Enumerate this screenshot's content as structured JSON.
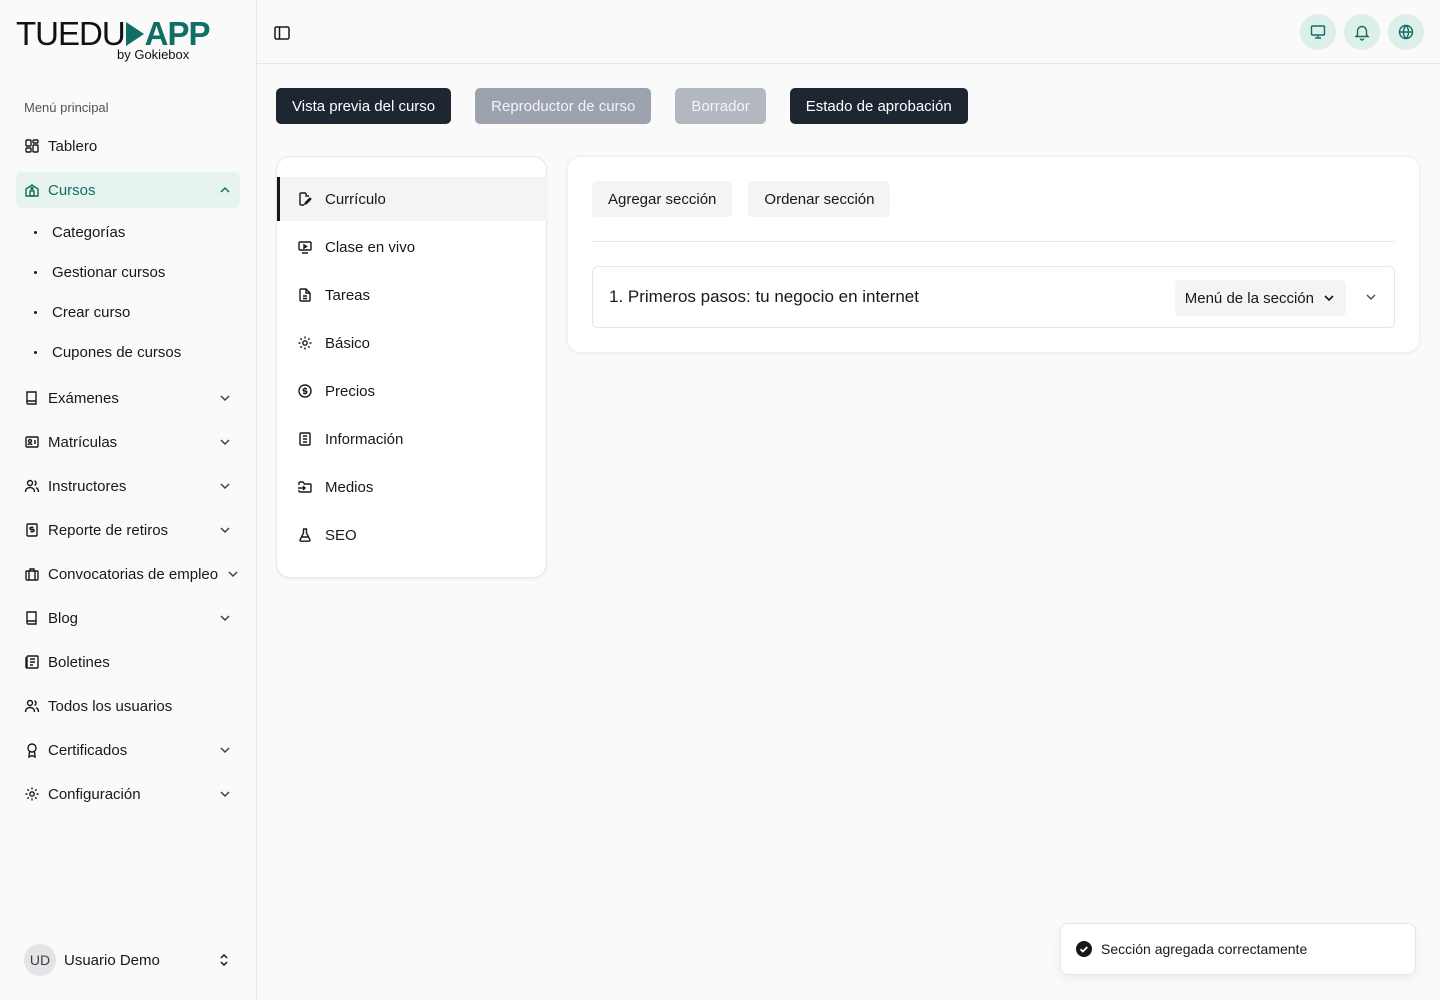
{
  "brand": {
    "part1": "TUE",
    "part2": "DU",
    "part3": "APP",
    "tagline": "by Gokiebox"
  },
  "sidebar": {
    "menu_label": "Menú principal",
    "items": [
      {
        "label": "Tablero",
        "icon": "dashboard-icon"
      },
      {
        "label": "Cursos",
        "icon": "courses-icon",
        "active": true,
        "expanded": true,
        "sub": [
          "Categorías",
          "Gestionar cursos",
          "Crear curso",
          "Cupones de cursos"
        ]
      },
      {
        "label": "Exámenes",
        "icon": "book-icon"
      },
      {
        "label": "Matrículas",
        "icon": "id-card-icon"
      },
      {
        "label": "Instructores",
        "icon": "users-icon"
      },
      {
        "label": "Reporte de retiros",
        "icon": "money-report-icon"
      },
      {
        "label": "Convocatorias de empleo",
        "icon": "briefcase-icon"
      },
      {
        "label": "Blog",
        "icon": "book-open-icon"
      },
      {
        "label": "Boletines",
        "icon": "newspaper-icon"
      },
      {
        "label": "Todos los usuarios",
        "icon": "users-icon"
      },
      {
        "label": "Certificados",
        "icon": "award-icon"
      },
      {
        "label": "Configuración",
        "icon": "gear-icon"
      }
    ],
    "user": {
      "initials": "UD",
      "name": "Usuario Demo"
    }
  },
  "toolbar": {
    "preview": "Vista previa del curso",
    "player": "Reproductor de curso",
    "draft": "Borrador",
    "approval": "Estado de aprobación"
  },
  "tabs": [
    {
      "label": "Currículo",
      "icon": "edit-file-icon",
      "active": true
    },
    {
      "label": "Clase en vivo",
      "icon": "live-class-icon"
    },
    {
      "label": "Tareas",
      "icon": "file-text-icon"
    },
    {
      "label": "Básico",
      "icon": "gear-icon"
    },
    {
      "label": "Precios",
      "icon": "dollar-circle-icon"
    },
    {
      "label": "Información",
      "icon": "document-icon"
    },
    {
      "label": "Medios",
      "icon": "folder-input-icon"
    },
    {
      "label": "SEO",
      "icon": "flask-icon"
    }
  ],
  "curriculum": {
    "add_section": "Agregar sección",
    "order_section": "Ordenar sección",
    "sections": [
      {
        "title": "1. Primeros pasos: tu negocio en internet",
        "menu_label": "Menú de la sección"
      }
    ]
  },
  "toast": {
    "message": "Sección agregada correctamente"
  },
  "colors": {
    "accent": "#0f6f64",
    "active_bg": "#e6f3ef",
    "dark_button": "#1e2632"
  }
}
